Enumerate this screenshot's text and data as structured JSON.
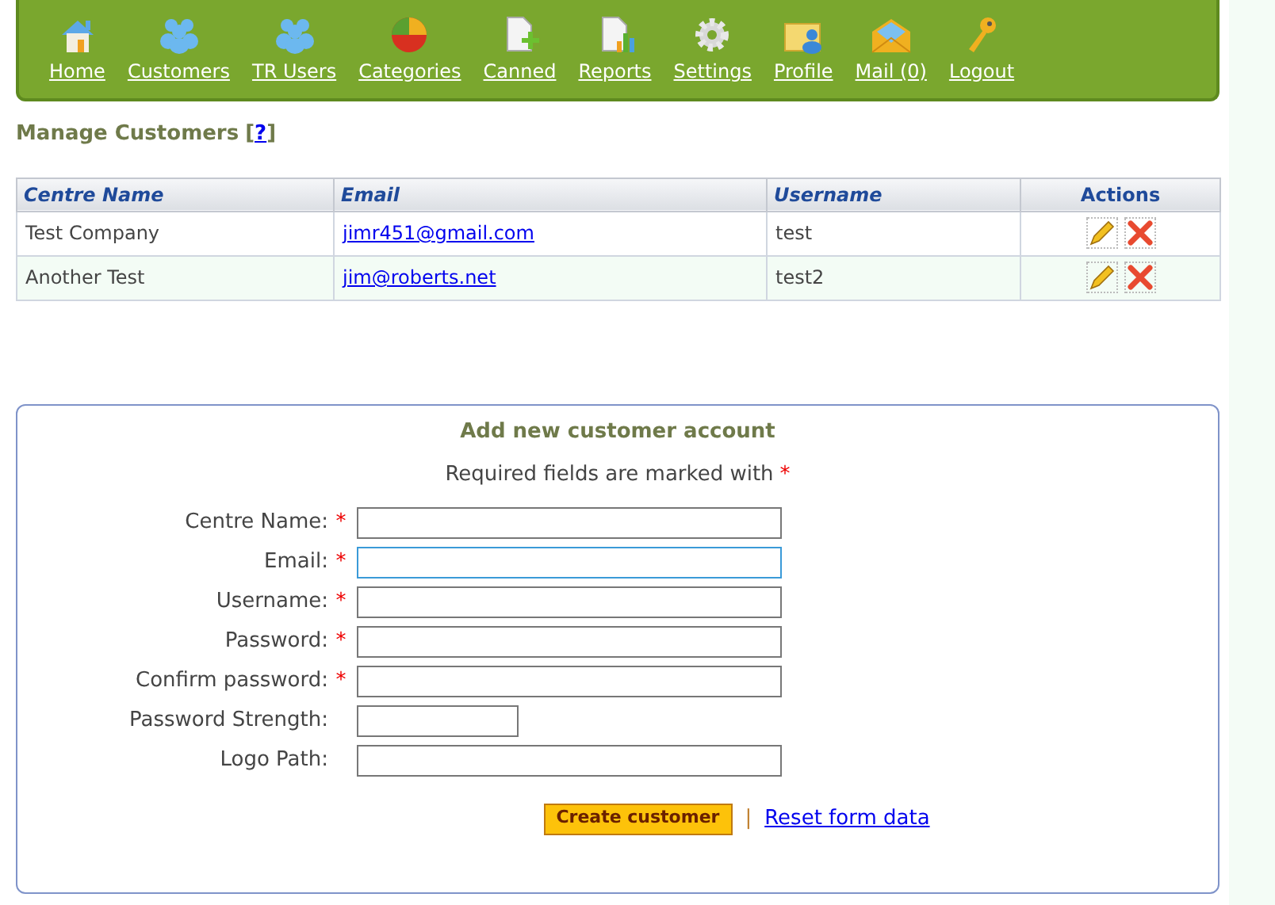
{
  "nav": [
    {
      "label": "Home"
    },
    {
      "label": "Customers"
    },
    {
      "label": "TR Users"
    },
    {
      "label": "Categories"
    },
    {
      "label": "Canned"
    },
    {
      "label": "Reports"
    },
    {
      "label": "Settings"
    },
    {
      "label": "Profile"
    },
    {
      "label": "Mail (0)"
    },
    {
      "label": "Logout"
    }
  ],
  "heading": {
    "title": "Manage Customers",
    "help_open": "[",
    "help_link": "?",
    "help_close": "]"
  },
  "table": {
    "columns": [
      "Centre Name",
      "Email",
      "Username",
      "Actions"
    ],
    "rows": [
      {
        "centre_name": "Test Company",
        "email": "jimr451@gmail.com",
        "username": "test"
      },
      {
        "centre_name": "Another Test",
        "email": "jim@roberts.net",
        "username": "test2"
      }
    ]
  },
  "form": {
    "title": "Add new customer account",
    "note": "Required fields are marked with",
    "note_mark": "*",
    "fields": [
      {
        "label": "Centre Name:",
        "required": true,
        "kind": "wide",
        "focused": false
      },
      {
        "label": "Email:",
        "required": true,
        "kind": "wide",
        "focused": true
      },
      {
        "label": "Username:",
        "required": true,
        "kind": "wide",
        "focused": false
      },
      {
        "label": "Password:",
        "required": true,
        "kind": "wide",
        "focused": false
      },
      {
        "label": "Confirm password:",
        "required": true,
        "kind": "wide",
        "focused": false
      },
      {
        "label": "Password Strength:",
        "required": false,
        "kind": "short",
        "focused": false
      },
      {
        "label": "Logo Path:",
        "required": false,
        "kind": "wide",
        "focused": false
      }
    ],
    "submit": "Create customer",
    "separator": "|",
    "reset": "Reset form data"
  }
}
